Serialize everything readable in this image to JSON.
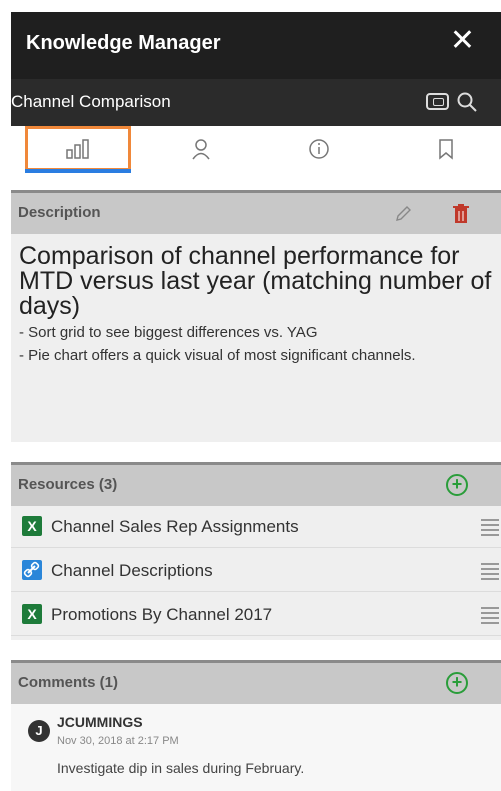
{
  "header": {
    "title": "Knowledge Manager",
    "close_glyph": "✕"
  },
  "subheader": {
    "title": "Channel Comparison",
    "icons": [
      "presentation-icon",
      "search-icon"
    ]
  },
  "tabs": [
    {
      "name": "chart",
      "icon": "bar-chart-icon",
      "active": true
    },
    {
      "name": "user",
      "icon": "user-icon",
      "active": false
    },
    {
      "name": "info",
      "icon": "info-icon",
      "active": false
    },
    {
      "name": "bookmark",
      "icon": "bookmark-icon",
      "active": false
    }
  ],
  "description": {
    "label": "Description",
    "headline": "Comparison of channel performance for MTD versus last year (matching number of days)",
    "bullets": [
      "- Sort grid to see biggest differences vs. YAG",
      "- Pie chart offers a quick visual of most significant channels."
    ]
  },
  "resources": {
    "label": "Resources (3)",
    "items": [
      {
        "icon": "excel-icon",
        "glyph": "X",
        "label": "Channel Sales Rep Assignments"
      },
      {
        "icon": "link-icon",
        "glyph": "",
        "label": "Channel Descriptions"
      },
      {
        "icon": "excel-icon",
        "glyph": "X",
        "label": "Promotions By Channel 2017"
      }
    ]
  },
  "comments": {
    "label": "Comments (1)",
    "items": [
      {
        "avatar": "J",
        "author": "JCUMMINGS",
        "time": "Nov 30, 2018 at 2:17 PM",
        "text": "Investigate dip in sales during February."
      }
    ]
  },
  "colors": {
    "accent_orange": "#f0883a",
    "active_tab": "#2a7de1",
    "add_green": "#2a9d3a",
    "delete_red": "#c0392b",
    "excel_green": "#1e7b3a"
  }
}
